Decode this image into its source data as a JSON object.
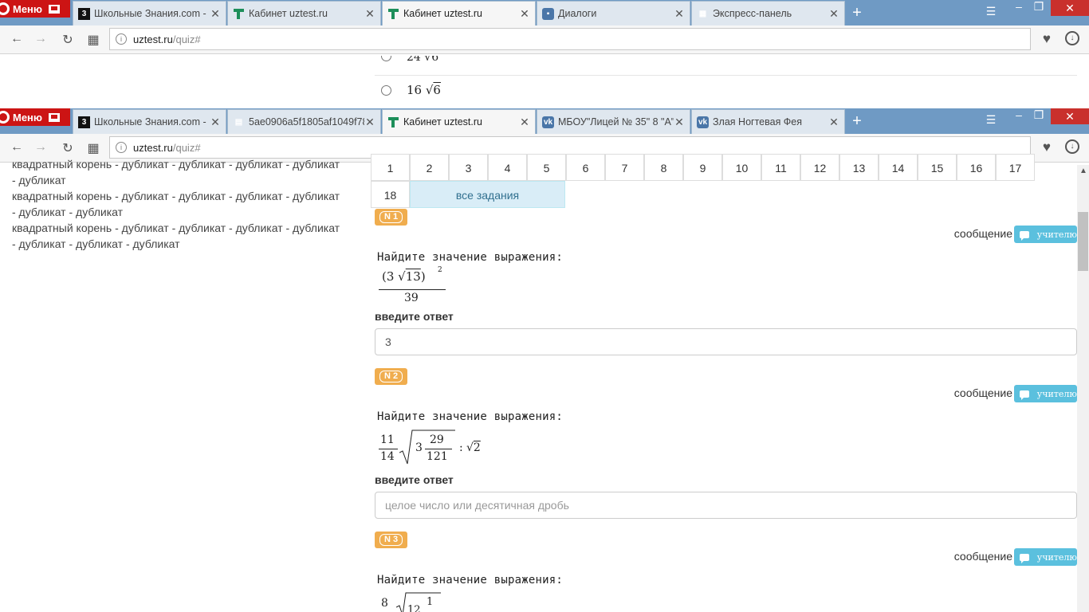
{
  "window1": {
    "menu_label": "Меню",
    "tabs": [
      {
        "title": "Школьные Знания.com - Е",
        "icon": "znanija-icon"
      },
      {
        "title": "Кабинет uztest.ru",
        "icon": "uztest-icon"
      },
      {
        "title": "Кабинет uztest.ru",
        "icon": "uztest-icon",
        "active": true
      },
      {
        "title": "Диалоги",
        "icon": "vk-icon"
      },
      {
        "title": "Экспресс-панель",
        "icon": "speed-dial-icon"
      }
    ],
    "url_host": "uztest.ru",
    "url_path": "/quiz#",
    "options": [
      {
        "coef": "24",
        "radicand": "6"
      },
      {
        "coef": "16",
        "radicand": "6"
      }
    ]
  },
  "window2": {
    "menu_label": "Меню",
    "tabs": [
      {
        "title": "Школьные Знания.com - Е",
        "icon": "znanija-icon"
      },
      {
        "title": "5ae0906a5f1805af1049f78",
        "icon": "document-icon"
      },
      {
        "title": "Кабинет uztest.ru",
        "icon": "uztest-icon",
        "active": true
      },
      {
        "title": "МБОУ\"Лицей № 35\" 8 \"А\"",
        "icon": "vk-icon"
      },
      {
        "title": "Злая Ногтевая Фея",
        "icon": "vk-icon"
      }
    ],
    "url_host": "uztest.ru",
    "url_path": "/quiz#"
  },
  "sidebar": {
    "lines": [
      "квадратный корень - дубликат - дубликат - дубликат - дубликат",
      "- дубликат",
      "квадратный корень - дубликат - дубликат - дубликат - дубликат",
      "- дубликат - дубликат",
      "квадратный корень - дубликат - дубликат - дубликат - дубликат",
      "- дубликат - дубликат - дубликат"
    ]
  },
  "task_nav": {
    "numbers": [
      "1",
      "2",
      "3",
      "4",
      "5",
      "6",
      "7",
      "8",
      "9",
      "10",
      "11",
      "12",
      "13",
      "14",
      "15",
      "16",
      "17",
      "18"
    ],
    "all_label": "все задания"
  },
  "questions": [
    {
      "badge": "N 1",
      "message_label": "сообщение",
      "teacher_label": "учителю",
      "prompt": "Найдите значение выражения:",
      "expr": {
        "coef": "3",
        "radicand": "13",
        "power": "2",
        "denominator": "39"
      },
      "answer_label": "введите ответ",
      "answer_value": "3",
      "placeholder": "целое число или десятичная дробь"
    },
    {
      "badge": "N 2",
      "message_label": "сообщение",
      "teacher_label": "учителю",
      "prompt": "Найдите значение выражения:",
      "expr": {
        "num": "11",
        "den": "14",
        "whole": "3",
        "frac_num": "29",
        "frac_den": "121",
        "op": ":",
        "radicand2": "2"
      },
      "answer_label": "введите ответ",
      "answer_value": "",
      "placeholder": "целое число или десятичная дробь"
    },
    {
      "badge": "N 3",
      "message_label": "сообщение",
      "teacher_label": "учителю",
      "prompt": "Найдите значение выражения:",
      "expr": {
        "num": "8",
        "whole": "12",
        "frac_num": "1"
      }
    }
  ]
}
